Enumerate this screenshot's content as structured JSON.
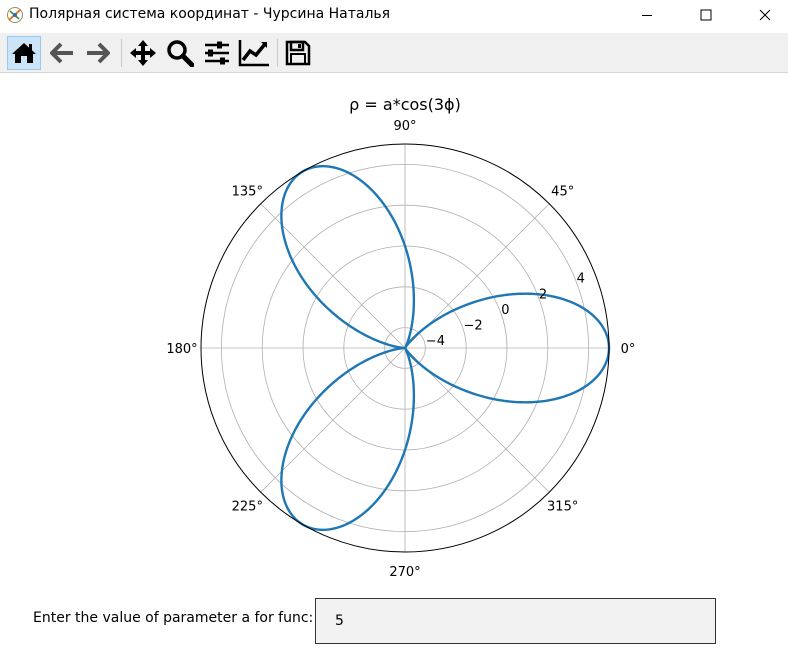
{
  "window": {
    "title": "Полярная система координат - Чурсина Наталья",
    "controls": [
      "minimize",
      "maximize",
      "close"
    ]
  },
  "toolbar": {
    "buttons": [
      {
        "icon": "home-icon",
        "active": true
      },
      {
        "icon": "back-arrow-icon"
      },
      {
        "icon": "forward-arrow-icon"
      },
      {
        "icon": "pan-icon"
      },
      {
        "icon": "zoom-icon"
      },
      {
        "icon": "subplots-config-icon"
      },
      {
        "icon": "edit-axis-icon"
      },
      {
        "icon": "save-icon"
      }
    ]
  },
  "chart_data": {
    "type": "line",
    "projection": "polar",
    "title": "ρ = a*cos(3ϕ)",
    "function": "a*cos(3*phi)",
    "parameter_a": 5,
    "angular_ticks": [
      "0°",
      "45°",
      "90°",
      "135°",
      "180°",
      "225°",
      "270°",
      "315°"
    ],
    "radial_ticks": [
      -4,
      -2,
      0,
      2,
      4
    ],
    "radial_tick_labels": [
      "−4",
      "−2",
      "0",
      "2",
      "4"
    ],
    "rlim": [
      -5,
      5
    ],
    "series": [
      {
        "color": "#1f77b4"
      }
    ],
    "grid": true,
    "colors": {
      "line": "#1f77b4",
      "grid": "#b0b0b0",
      "spine": "#000000"
    }
  },
  "input": {
    "label": "Enter the value of parameter a for func:",
    "value": "5"
  }
}
